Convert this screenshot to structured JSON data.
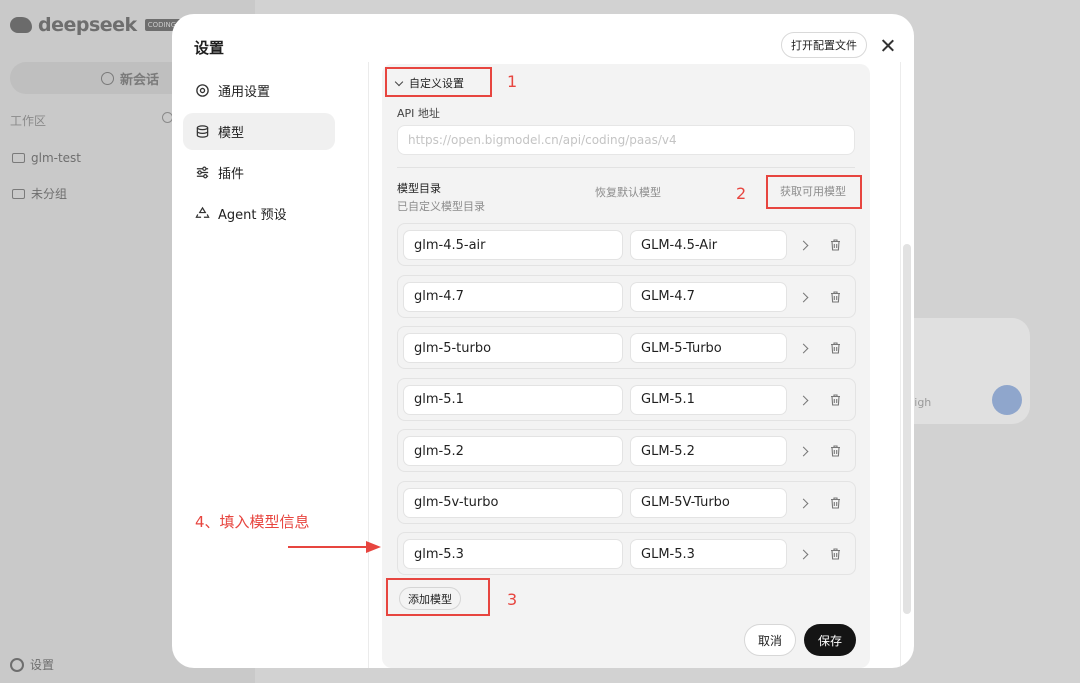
{
  "background": {
    "logo_text": "deepseek",
    "logo_tag": "CODING CLI",
    "new_chat_label": "新会话",
    "workspace_label": "工作区",
    "folders": [
      "glm-test",
      "未分组"
    ],
    "settings_label": "设置",
    "input_level": "High"
  },
  "modal": {
    "title": "设置",
    "open_config_label": "打开配置文件",
    "nav": [
      {
        "label": "通用设置",
        "icon": "gear-icon"
      },
      {
        "label": "模型",
        "icon": "database-icon",
        "active": true
      },
      {
        "label": "插件",
        "icon": "sliders-icon"
      },
      {
        "label": "Agent 预设",
        "icon": "recycle-icon"
      }
    ]
  },
  "model_settings": {
    "custom_toggle_label": "自定义设置",
    "api_label": "API 地址",
    "api_placeholder": "https://open.bigmodel.cn/api/coding/paas/v4",
    "catalog_title": "模型目录",
    "catalog_subtitle": "已自定义模型目录",
    "restore_label": "恢复默认模型",
    "fetch_label": "获取可用模型",
    "models": [
      {
        "id": "glm-4.5-air",
        "name": "GLM-4.5-Air"
      },
      {
        "id": "glm-4.7",
        "name": "GLM-4.7"
      },
      {
        "id": "glm-5-turbo",
        "name": "GLM-5-Turbo"
      },
      {
        "id": "glm-5.1",
        "name": "GLM-5.1"
      },
      {
        "id": "glm-5.2",
        "name": "GLM-5.2"
      },
      {
        "id": "glm-5v-turbo",
        "name": "GLM-5V-Turbo"
      },
      {
        "id": "glm-5.3",
        "name": "GLM-5.3"
      }
    ],
    "add_model_label": "添加模型",
    "cancel_label": "取消",
    "save_label": "保存"
  },
  "annotations": {
    "step1": "1",
    "step2": "2",
    "step3": "3",
    "step4": "4、填入模型信息",
    "color": "#e7453f"
  }
}
